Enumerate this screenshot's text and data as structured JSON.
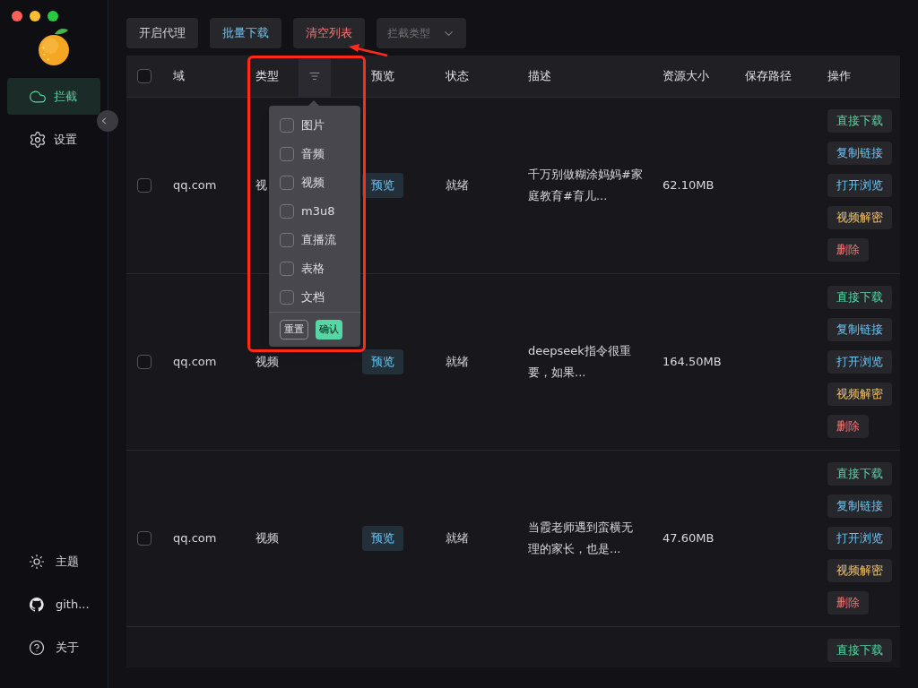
{
  "toolbar": [
    {
      "label": "开启代理",
      "kind": "plain"
    },
    {
      "label": "批量下载",
      "kind": "info"
    },
    {
      "label": "清空列表",
      "kind": "danger"
    }
  ],
  "type_select": {
    "placeholder": "拦截类型"
  },
  "sidebar": {
    "items": [
      {
        "label": "拦截",
        "selected": true
      },
      {
        "label": "设置",
        "selected": false
      }
    ],
    "bottom_items": [
      {
        "label": "主题"
      },
      {
        "label": "gith..."
      },
      {
        "label": "关于"
      }
    ]
  },
  "table": {
    "columns": [
      "域",
      "类型",
      "预览",
      "状态",
      "描述",
      "资源大小",
      "保存路径",
      "操作"
    ],
    "select_all_checked": false,
    "rows": [
      {
        "checked": false,
        "domain": "qq.com",
        "type": "视",
        "preview": "预览",
        "status": "就绪",
        "description": "千万别做糊涂妈妈#家庭教育#育儿...",
        "size": "62.10MB",
        "actions": [
          {
            "label": "直接下载",
            "kind": "download"
          },
          {
            "label": "复制链接",
            "kind": "copy"
          },
          {
            "label": "打开浏览",
            "kind": "open"
          },
          {
            "label": "视频解密",
            "kind": "decrypt"
          },
          {
            "label": "删除",
            "kind": "delete"
          }
        ]
      },
      {
        "checked": false,
        "domain": "qq.com",
        "type": "视频",
        "preview": "预览",
        "status": "就绪",
        "description": "deepseek指令很重要，如果...",
        "size": "164.50MB",
        "actions": [
          {
            "label": "直接下载",
            "kind": "download"
          },
          {
            "label": "复制链接",
            "kind": "copy"
          },
          {
            "label": "打开浏览",
            "kind": "open"
          },
          {
            "label": "视频解密",
            "kind": "decrypt"
          },
          {
            "label": "删除",
            "kind": "delete"
          }
        ]
      },
      {
        "checked": false,
        "domain": "qq.com",
        "type": "视频",
        "preview": "预览",
        "status": "就绪",
        "description": "当霞老师遇到蛮横无理的家长，也是...",
        "size": "47.60MB",
        "actions": [
          {
            "label": "直接下载",
            "kind": "download"
          },
          {
            "label": "复制链接",
            "kind": "copy"
          },
          {
            "label": "打开浏览",
            "kind": "open"
          },
          {
            "label": "视频解密",
            "kind": "decrypt"
          },
          {
            "label": "删除",
            "kind": "delete"
          }
        ]
      },
      {
        "actions": [
          {
            "label": "直接下载",
            "kind": "download"
          }
        ]
      }
    ]
  },
  "type_filter": {
    "options": [
      {
        "label": "图片",
        "checked": false
      },
      {
        "label": "音频",
        "checked": false
      },
      {
        "label": "视频",
        "checked": false
      },
      {
        "label": "m3u8",
        "checked": false
      },
      {
        "label": "直播流",
        "checked": false
      },
      {
        "label": "表格",
        "checked": false
      },
      {
        "label": "文档",
        "checked": false
      }
    ],
    "reset": "重置",
    "confirm": "确认"
  }
}
